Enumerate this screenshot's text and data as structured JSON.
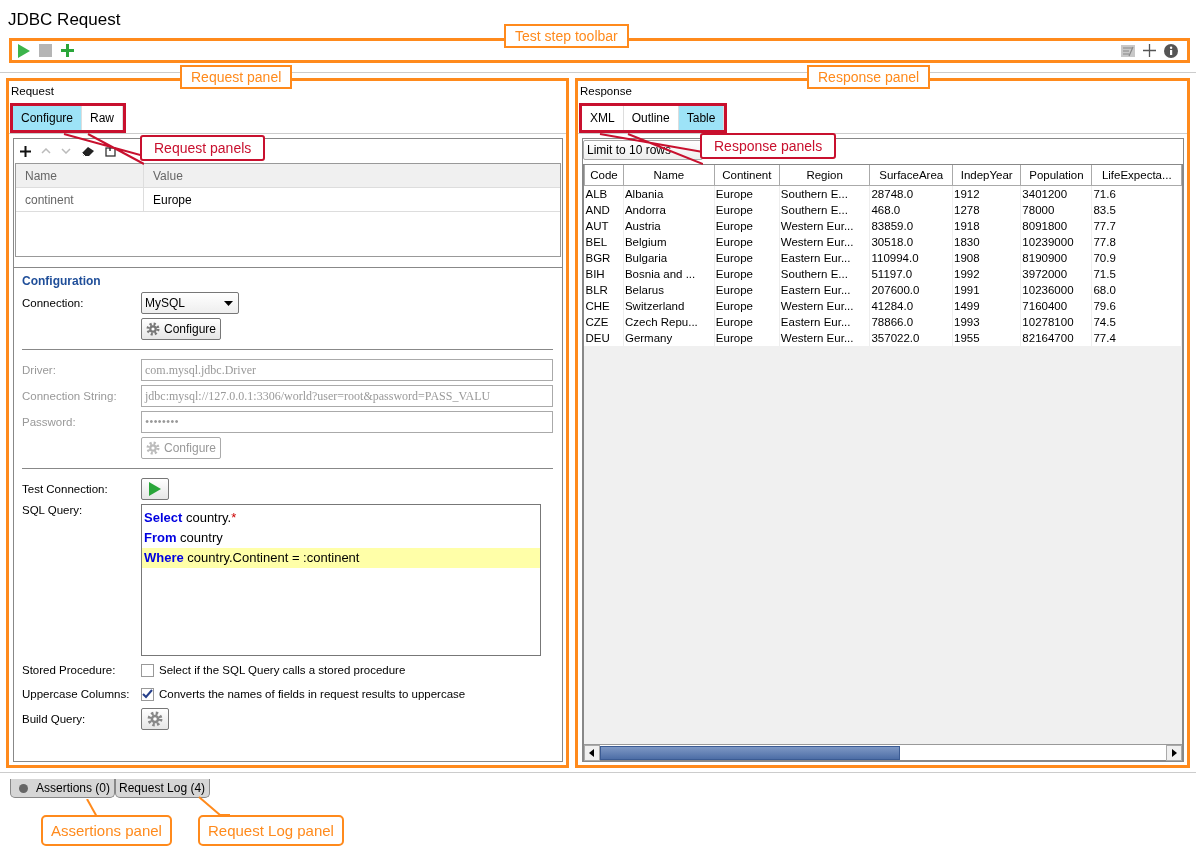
{
  "title": "JDBC Request",
  "toolbar": {
    "callout": "Test step toolbar"
  },
  "request": {
    "label": "Request",
    "callout": "Request panel",
    "tabs_callout": "Request panels",
    "tabs": [
      {
        "label": "Configure",
        "selected": true
      },
      {
        "label": "Raw",
        "selected": false
      }
    ],
    "properties": {
      "columns": [
        "Name",
        "Value"
      ],
      "rows": [
        [
          "continent",
          "Europe"
        ]
      ]
    },
    "configuration": {
      "heading": "Configuration",
      "connection": {
        "label": "Connection:",
        "value": "MySQL"
      },
      "configure_button": {
        "label": "Configure",
        "disabled": false
      },
      "fields": [
        {
          "label": "Driver:",
          "value": "com.mysql.jdbc.Driver",
          "disabled": true
        },
        {
          "label": "Connection String:",
          "value": "jdbc:mysql://127.0.0.1:3306/world?user=root&password=PASS_VALU",
          "disabled": true
        },
        {
          "label": "Password:",
          "value": "••••••••",
          "disabled": true
        }
      ],
      "configure_button_2": {
        "label": "Configure",
        "disabled": true
      },
      "test_connection": {
        "label": "Test Connection:"
      },
      "sql": {
        "label": "SQL Query:",
        "lines": [
          {
            "highlighted": false,
            "tokens": [
              {
                "text": "Select",
                "kind": "keyword"
              },
              {
                "text": " country.",
                "kind": "plain"
              },
              {
                "text": "*",
                "kind": "symbol"
              }
            ]
          },
          {
            "highlighted": false,
            "tokens": [
              {
                "text": "From",
                "kind": "keyword"
              },
              {
                "text": " country",
                "kind": "plain"
              }
            ]
          },
          {
            "highlighted": true,
            "tokens": [
              {
                "text": "Where",
                "kind": "keyword"
              },
              {
                "text": " country.Continent = :continent",
                "kind": "plain"
              }
            ]
          }
        ]
      },
      "checks": [
        {
          "label": "Stored Procedure:",
          "text": "Select if the SQL Query calls a stored procedure",
          "checked": false
        },
        {
          "label": "Uppercase Columns:",
          "text": "Converts the names of fields in request results to uppercase",
          "checked": true
        }
      ],
      "build_query": {
        "label": "Build Query:"
      }
    }
  },
  "response": {
    "label": "Response",
    "callout": "Response panel",
    "tabs_callout": "Response panels",
    "tabs": [
      {
        "label": "XML",
        "selected": false
      },
      {
        "label": "Outline",
        "selected": false
      },
      {
        "label": "Table",
        "selected": true
      }
    ],
    "limit_button": "Limit to 10 rows",
    "table": {
      "columns": [
        "Code",
        "Name",
        "Continent",
        "Region",
        "SurfaceArea",
        "IndepYear",
        "Population",
        "LifeExpecta..."
      ],
      "rows": [
        [
          "ALB",
          "Albania",
          "Europe",
          "Southern E...",
          "28748.0",
          "1912",
          "3401200",
          "71.6"
        ],
        [
          "AND",
          "Andorra",
          "Europe",
          "Southern E...",
          "468.0",
          "1278",
          "78000",
          "83.5"
        ],
        [
          "AUT",
          "Austria",
          "Europe",
          "Western Eur...",
          "83859.0",
          "1918",
          "8091800",
          "77.7"
        ],
        [
          "BEL",
          "Belgium",
          "Europe",
          "Western Eur...",
          "30518.0",
          "1830",
          "10239000",
          "77.8"
        ],
        [
          "BGR",
          "Bulgaria",
          "Europe",
          "Eastern Eur...",
          "110994.0",
          "1908",
          "8190900",
          "70.9"
        ],
        [
          "BIH",
          "Bosnia and ...",
          "Europe",
          "Southern E...",
          "51197.0",
          "1992",
          "3972000",
          "71.5"
        ],
        [
          "BLR",
          "Belarus",
          "Europe",
          "Eastern Eur...",
          "207600.0",
          "1991",
          "10236000",
          "68.0"
        ],
        [
          "CHE",
          "Switzerland",
          "Europe",
          "Western Eur...",
          "41284.0",
          "1499",
          "7160400",
          "79.6"
        ],
        [
          "CZE",
          "Czech Repu...",
          "Europe",
          "Eastern Eur...",
          "78866.0",
          "1993",
          "10278100",
          "74.5"
        ],
        [
          "DEU",
          "Germany",
          "Europe",
          "Western Eur...",
          "357022.0",
          "1955",
          "82164700",
          "77.4"
        ]
      ]
    }
  },
  "bottom_tabs": [
    {
      "label": "Assertions (0)",
      "callout": "Assertions panel"
    },
    {
      "label": "Request Log (4)",
      "callout": "Request Log panel"
    }
  ]
}
